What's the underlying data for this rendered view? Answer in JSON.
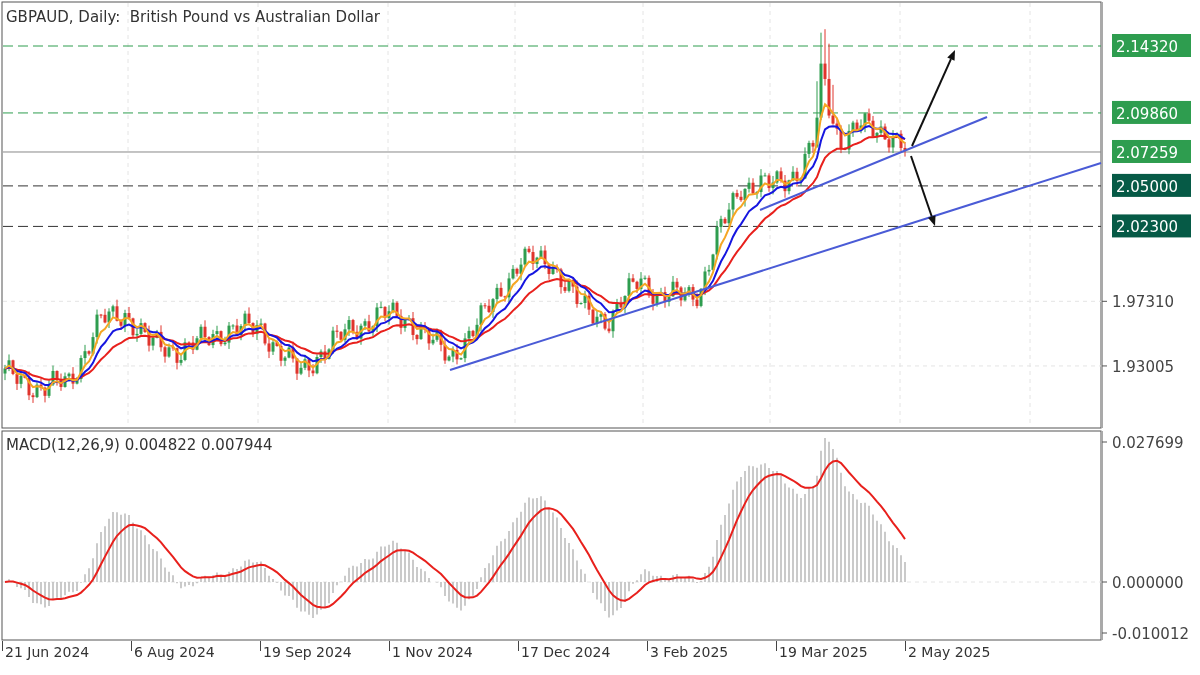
{
  "title": "GBPAUD, Daily:  British Pound vs Australian Dollar",
  "price_axis": {
    "ticks": [
      "1.97310",
      "1.93005"
    ],
    "badges": [
      {
        "text": "2.14320",
        "kind": "level",
        "color": "#2e9d4f"
      },
      {
        "text": "2.09860",
        "kind": "level",
        "color": "#2e9d4f"
      },
      {
        "text": "2.07259",
        "kind": "price",
        "color": "#2e9d4f"
      },
      {
        "text": "2.05000",
        "kind": "level",
        "color": "#065a46"
      },
      {
        "text": "2.02300",
        "kind": "level",
        "color": "#065a46"
      }
    ]
  },
  "macd": {
    "label": "MACD(12,26,9) 0.004822 0.007944",
    "ticks": [
      "0.027699",
      "0.000000",
      "-0.010012"
    ]
  },
  "dates": [
    "21 Jun 2024",
    "6 Aug 2024",
    "19 Sep 2024",
    "1 Nov 2024",
    "17 Dec 2024",
    "3 Feb 2025",
    "19 Mar 2025",
    "2 May 2025"
  ]
}
